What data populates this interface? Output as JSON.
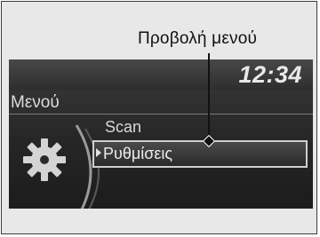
{
  "callout": {
    "label": "Προβολή μενού"
  },
  "screen": {
    "clock": "12:34",
    "menu_title": "Μενού",
    "items": [
      {
        "label": "Scan",
        "selected": false
      },
      {
        "label": "Ρυθμίσεις",
        "selected": true
      }
    ],
    "icon": "gear-icon"
  },
  "colors": {
    "screen_bg": "#262626",
    "text": "#dcdcdc",
    "highlight_border": "#cfcfcf"
  }
}
